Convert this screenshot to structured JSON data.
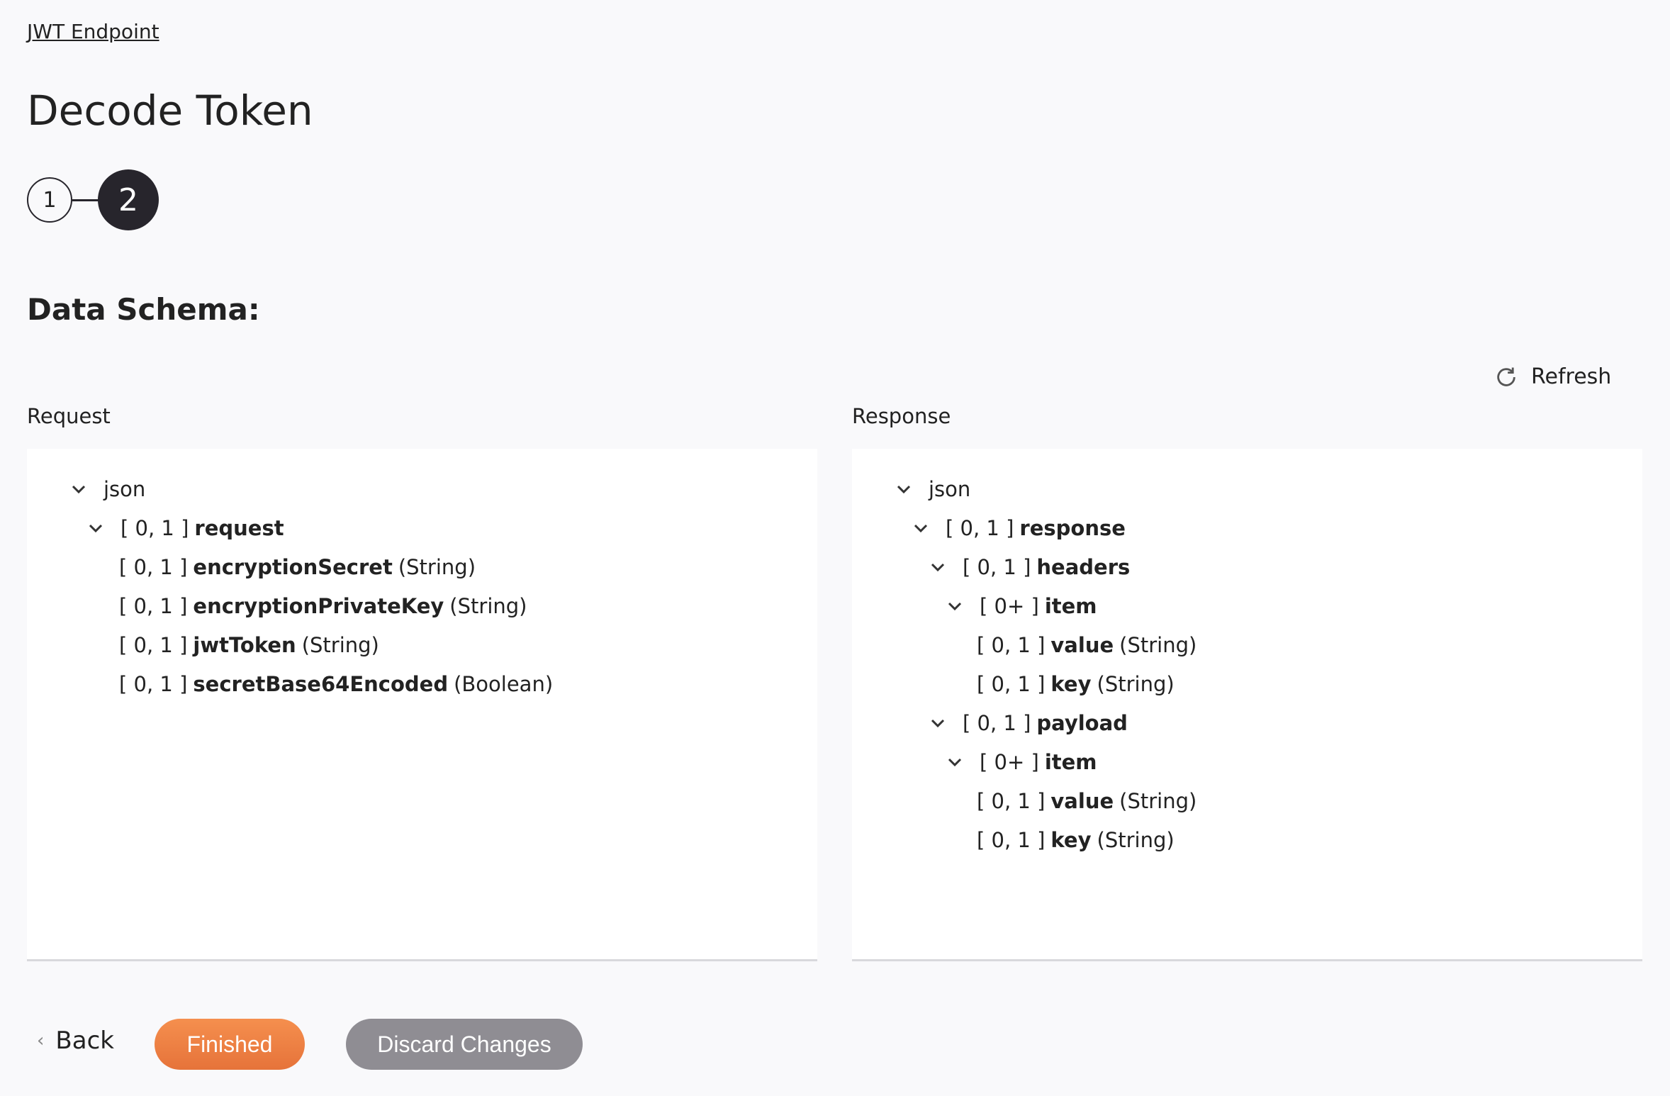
{
  "breadcrumb": "JWT Endpoint",
  "title": "Decode Token",
  "steps": [
    "1",
    "2"
  ],
  "current_step": 2,
  "section_title": "Data Schema:",
  "refresh_label": "Refresh",
  "request": {
    "label": "Request",
    "rows": [
      {
        "level": 0,
        "chev": true,
        "card": "",
        "name": "json",
        "type": "",
        "plain": true
      },
      {
        "level": 1,
        "chev": true,
        "card": "[ 0, 1 ]",
        "name": "request",
        "type": ""
      },
      {
        "level": 2,
        "chev": false,
        "card": "[ 0, 1 ]",
        "name": "encryptionSecret",
        "type": "(String)"
      },
      {
        "level": 2,
        "chev": false,
        "card": "[ 0, 1 ]",
        "name": "encryptionPrivateKey",
        "type": "(String)"
      },
      {
        "level": 2,
        "chev": false,
        "card": "[ 0, 1 ]",
        "name": "jwtToken",
        "type": "(String)"
      },
      {
        "level": 2,
        "chev": false,
        "card": "[ 0, 1 ]",
        "name": "secretBase64Encoded",
        "type": "(Boolean)"
      }
    ]
  },
  "response": {
    "label": "Response",
    "rows": [
      {
        "level": 0,
        "chev": true,
        "card": "",
        "name": "json",
        "type": "",
        "plain": true
      },
      {
        "level": 1,
        "chev": true,
        "card": "[ 0, 1 ]",
        "name": "response",
        "type": ""
      },
      {
        "level": 2,
        "chev": true,
        "card": "[ 0, 1 ]",
        "name": "headers",
        "type": ""
      },
      {
        "level": 3,
        "chev": true,
        "card": "[ 0+ ]",
        "name": "item",
        "type": ""
      },
      {
        "level": 4,
        "chev": false,
        "card": "[ 0, 1 ]",
        "name": "value",
        "type": "(String)"
      },
      {
        "level": 4,
        "chev": false,
        "card": "[ 0, 1 ]",
        "name": "key",
        "type": "(String)"
      },
      {
        "level": 2,
        "chev": true,
        "card": "[ 0, 1 ]",
        "name": "payload",
        "type": ""
      },
      {
        "level": 3,
        "chev": true,
        "card": "[ 0+ ]",
        "name": "item",
        "type": ""
      },
      {
        "level": 4,
        "chev": false,
        "card": "[ 0, 1 ]",
        "name": "value",
        "type": "(String)"
      },
      {
        "level": 4,
        "chev": false,
        "card": "[ 0, 1 ]",
        "name": "key",
        "type": "(String)"
      }
    ]
  },
  "buttons": {
    "back": "Back",
    "finished": "Finished",
    "discard": "Discard Changes"
  },
  "colors": {
    "primary": "#ee7f43",
    "secondary": "#8f8d93",
    "dark": "#27252c"
  }
}
